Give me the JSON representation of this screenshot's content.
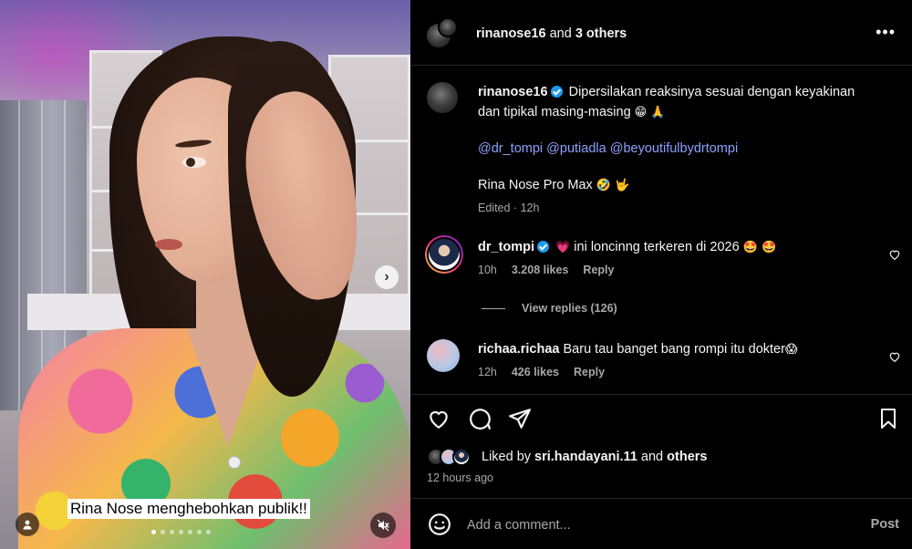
{
  "post": {
    "header": {
      "author": "rinanose16",
      "and_text": "and",
      "others": "3 others"
    },
    "caption": {
      "author": "rinanose16",
      "text_line1": "Dipersilakan reaksinya sesuai dengan keyakinan",
      "text_line2": "dan tipikal masing-masing",
      "emojis": "😁 🙏",
      "mentions": [
        "@dr_tompi",
        "@putiadla",
        "@beyoutifulbydrtompi"
      ],
      "tagline": "Rina Nose Pro Max",
      "tagline_emojis": "🤣 🤟",
      "edited": "Edited",
      "time": "12h"
    },
    "media": {
      "overlay_caption": "Rina Nose menghebohkan publik!!",
      "slides_total": 7,
      "slide_active": 1
    }
  },
  "comments": [
    {
      "user": "dr_tompi",
      "verified": true,
      "heart": "💗",
      "text": "ini loncinng terkeren di 2026",
      "emojis": "🤩 🤩",
      "time": "10h",
      "likes": "3.208 likes",
      "reply": "Reply",
      "view_replies": "View replies (126)"
    },
    {
      "user": "richaa.richaa",
      "verified": false,
      "text": "Baru tau banget bang rompi itu dokter",
      "emojis": "😱",
      "time": "12h",
      "likes": "426 likes",
      "reply": "Reply"
    }
  ],
  "likes": {
    "prefix": "Liked by",
    "user": "sri.handayani.11",
    "and_text": "and",
    "others": "others",
    "posted": "12 hours ago"
  },
  "composer": {
    "placeholder": "Add a comment...",
    "post_label": "Post"
  },
  "icons": {
    "like": "heart-icon",
    "comment": "comment-icon",
    "share": "share-icon",
    "save": "bookmark-icon",
    "more": "more-icon",
    "emoji": "smiley-icon",
    "next": "chevron-right-icon",
    "mute": "speaker-muted-icon",
    "tags": "user-icon"
  },
  "colors": {
    "background": "#000000",
    "text": "#f5f5f5",
    "muted": "#a8a8a8",
    "link": "#8da1ff",
    "verified": "#1d9bf0",
    "divider": "#262626"
  }
}
